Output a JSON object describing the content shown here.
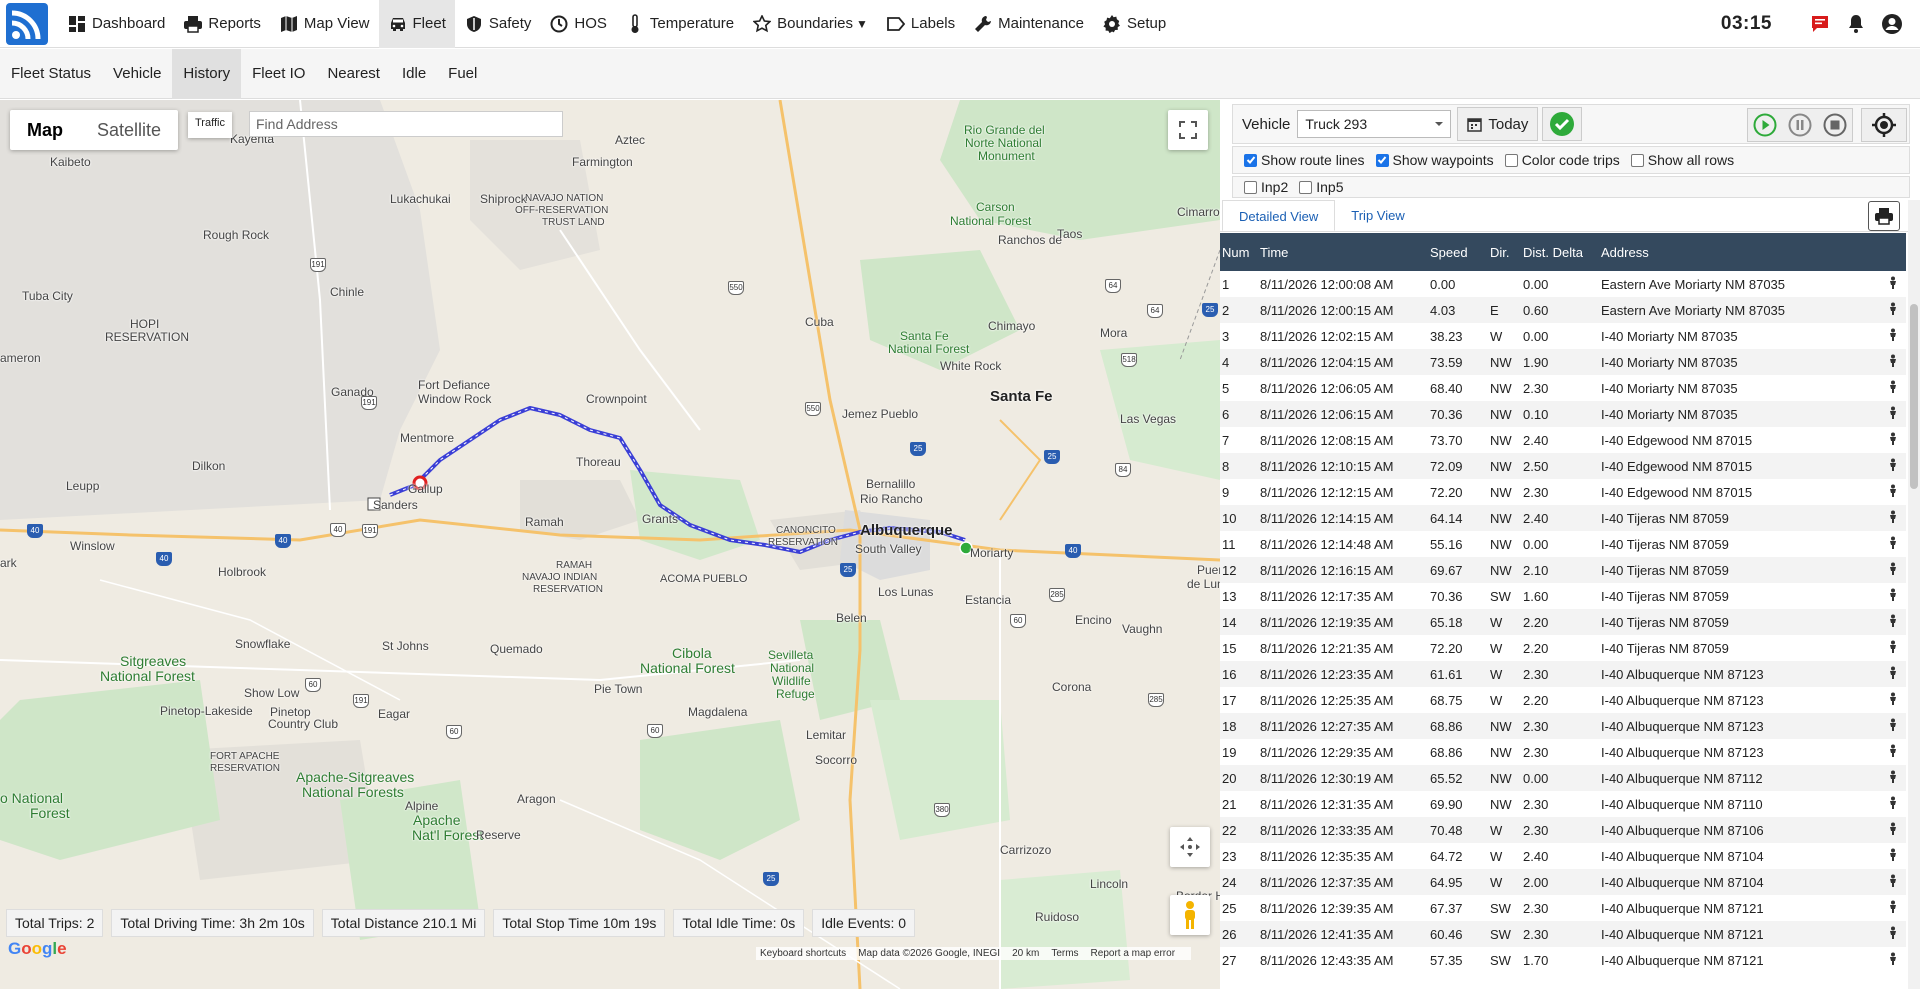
{
  "nav": {
    "items": [
      {
        "label": "Dashboard",
        "icon": "dashboard-icon"
      },
      {
        "label": "Reports",
        "icon": "printer-icon"
      },
      {
        "label": "Map View",
        "icon": "map-icon"
      },
      {
        "label": "Fleet",
        "icon": "car-icon",
        "active": true
      },
      {
        "label": "Safety",
        "icon": "shield-icon"
      },
      {
        "label": "HOS",
        "icon": "clock-icon"
      },
      {
        "label": "Temperature",
        "icon": "thermometer-icon"
      },
      {
        "label": "Boundaries",
        "icon": "star-icon",
        "caret": "▼"
      },
      {
        "label": "Labels",
        "icon": "tag-icon"
      },
      {
        "label": "Maintenance",
        "icon": "wrench-icon"
      },
      {
        "label": "Setup",
        "icon": "gear-icon"
      }
    ],
    "clock": "03:15"
  },
  "subnav": [
    "Fleet Status",
    "Vehicle",
    "History",
    "Fleet IO",
    "Nearest",
    "Idle",
    "Fuel"
  ],
  "subnav_active": "History",
  "map": {
    "type_map": "Map",
    "type_satellite": "Satellite",
    "traffic": "Traffic",
    "find_placeholder": "Find Address",
    "google": "Google",
    "attribution": [
      "Keyboard shortcuts",
      "Map data ©2026 Google, INEGI",
      "20 km",
      "Terms",
      "Report a map error"
    ],
    "labels": {
      "aztec": "Aztec",
      "farmington": "Farmington",
      "shiprock": "Shiprock",
      "kayenta": "Kayenta",
      "kaibeto": "Kaibeto",
      "rough_rock": "Rough Rock",
      "chinle": "Chinle",
      "tuba_city": "Tuba City",
      "lukachukai": "Lukachukai",
      "navajo_1": "NAVAJO NATION",
      "navajo_2": "OFF-RESERVATION",
      "navajo_3": "TRUST LAND",
      "rio_grande_1": "Rio Grande del",
      "rio_grande_2": "Norte National",
      "rio_grande_3": "Monument",
      "carson_1": "Carson",
      "carson_2": "National Forest",
      "ranchos": "Ranchos de",
      "taos": "Taos",
      "cimarron": "Cimarron",
      "cuba": "Cuba",
      "chimayo": "Chimayo",
      "santafe_nf_1": "Santa Fe",
      "santafe_nf_2": "National Forest",
      "white_rock": "White Rock",
      "mora": "Mora",
      "santa_fe": "Santa Fe",
      "las_vegas": "Las Vegas",
      "hopi_1": "HOPI",
      "hopi_2": "RESERVATION",
      "cameron": "ameron",
      "ganado": "Ganado",
      "fort_defiance": "Fort Defiance",
      "window_rock": "Window Rock",
      "crownpoint": "Crownpoint",
      "jemez": "Jemez Pueblo",
      "mentmore": "Mentmore",
      "thoreau": "Thoreau",
      "dilkon": "Dilkon",
      "leupp": "Leupp",
      "gallup": "Gallup",
      "sanders": "Sanders",
      "grants": "Grants",
      "ramah": "Ramah",
      "bernalillo": "Bernalillo",
      "rio_rancho": "Rio Rancho",
      "albuquerque": "Albuquerque",
      "south_valley": "South Valley",
      "moriarty": "Moriarty",
      "canoncito_1": "CANONCITO",
      "canoncito_2": "RESERVATION",
      "puerto": "Puerto",
      "de_luna": "de Luna",
      "winslow": "Winslow",
      "holbrook": "Holbrook",
      "park": "ark",
      "ramah_nav_1": "RAMAH",
      "ramah_nav_2": "NAVAJO INDIAN",
      "ramah_nav_3": "RESERVATION",
      "acoma": "ACOMA PUEBLO",
      "los_lunas": "Los Lunas",
      "estancia": "Estancia",
      "encino": "Encino",
      "belen": "Belen",
      "vaughn": "Vaughn",
      "snowflake": "Snowflake",
      "sitgreaves_1": "Sitgreaves",
      "sitgreaves_2": "National Forest",
      "st_johns": "St Johns",
      "quemado": "Quemado",
      "cibola_1": "Cibola",
      "cibola_2": "National Forest",
      "sevilleta_1": "Sevilleta",
      "sevilleta_2": "National",
      "sevilleta_3": "Wildlife",
      "sevilleta_4": "Refuge",
      "show_low": "Show Low",
      "pie_town": "Pie Town",
      "pinetop_1": "Pinetop-Lakeside",
      "pinetop_2": "Pinetop",
      "pinetop_3": "Country Club",
      "eagar": "Eagar",
      "magdalena": "Magdalena",
      "lemitar": "Lemitar",
      "socorro": "Socorro",
      "corona": "Corona",
      "fort_apache_1": "FORT APACHE",
      "fort_apache_2": "RESERVATION",
      "apache_sit_1": "Apache-Sitgreaves",
      "apache_sit_2": "National Forests",
      "onal_1": "o National",
      "onal_2": "Forest",
      "alpine": "Alpine",
      "apache_nf_1": "Apache",
      "apache_nf_2": "Nat'l Forest",
      "aragon": "Aragon",
      "reserve": "Reserve",
      "carrizozo": "Carrizozo",
      "lincoln": "Lincoln",
      "ruidoso": "Ruidoso",
      "border": "Border H"
    }
  },
  "stats": [
    "Total Trips: 2",
    "Total Driving Time: 3h 2m 10s",
    "Total Distance 210.1 Mi",
    "Total Stop Time 10m 19s",
    "Total Idle Time: 0s",
    "Idle Events: 0"
  ],
  "panel": {
    "vehicle_label": "Vehicle",
    "vehicle_value": "Truck 293",
    "today": "Today",
    "options": [
      {
        "label": "Show route lines",
        "checked": true
      },
      {
        "label": "Show waypoints",
        "checked": true
      },
      {
        "label": "Color code trips",
        "checked": false
      },
      {
        "label": "Show all rows",
        "checked": false
      }
    ],
    "inputs": [
      {
        "label": "Inp2",
        "checked": false
      },
      {
        "label": "Inp5",
        "checked": false
      }
    ],
    "tabs": [
      "Detailed View",
      "Trip View"
    ],
    "columns": [
      "Num",
      "Time",
      "Speed",
      "Dir.",
      "Dist. Delta",
      "Address"
    ],
    "rows": [
      [
        "1",
        "8/11/2026 12:00:08 AM",
        "0.00",
        "",
        "0.00",
        "Eastern Ave Moriarty NM 87035"
      ],
      [
        "2",
        "8/11/2026 12:00:15 AM",
        "4.03",
        "E",
        "0.60",
        "Eastern Ave Moriarty NM 87035"
      ],
      [
        "3",
        "8/11/2026 12:02:15 AM",
        "38.23",
        "W",
        "0.00",
        "I-40 Moriarty NM 87035"
      ],
      [
        "4",
        "8/11/2026 12:04:15 AM",
        "73.59",
        "NW",
        "1.90",
        "I-40 Moriarty NM 87035"
      ],
      [
        "5",
        "8/11/2026 12:06:05 AM",
        "68.40",
        "NW",
        "2.30",
        "I-40 Moriarty NM 87035"
      ],
      [
        "6",
        "8/11/2026 12:06:15 AM",
        "70.36",
        "NW",
        "0.10",
        "I-40 Moriarty NM 87035"
      ],
      [
        "7",
        "8/11/2026 12:08:15 AM",
        "73.70",
        "NW",
        "2.40",
        "I-40 Edgewood NM 87015"
      ],
      [
        "8",
        "8/11/2026 12:10:15 AM",
        "72.09",
        "NW",
        "2.50",
        "I-40 Edgewood NM 87015"
      ],
      [
        "9",
        "8/11/2026 12:12:15 AM",
        "72.20",
        "NW",
        "2.30",
        "I-40 Edgewood NM 87015"
      ],
      [
        "10",
        "8/11/2026 12:14:15 AM",
        "64.14",
        "NW",
        "2.40",
        "I-40 Tijeras NM 87059"
      ],
      [
        "11",
        "8/11/2026 12:14:48 AM",
        "55.16",
        "NW",
        "0.00",
        "I-40 Tijeras NM 87059"
      ],
      [
        "12",
        "8/11/2026 12:16:15 AM",
        "69.67",
        "NW",
        "2.10",
        "I-40 Tijeras NM 87059"
      ],
      [
        "13",
        "8/11/2026 12:17:35 AM",
        "70.36",
        "SW",
        "1.60",
        "I-40 Tijeras NM 87059"
      ],
      [
        "14",
        "8/11/2026 12:19:35 AM",
        "65.18",
        "W",
        "2.20",
        "I-40 Tijeras NM 87059"
      ],
      [
        "15",
        "8/11/2026 12:21:35 AM",
        "72.20",
        "W",
        "2.20",
        "I-40 Tijeras NM 87059"
      ],
      [
        "16",
        "8/11/2026 12:23:35 AM",
        "61.61",
        "W",
        "2.30",
        "I-40 Albuquerque NM 87123"
      ],
      [
        "17",
        "8/11/2026 12:25:35 AM",
        "68.75",
        "W",
        "2.20",
        "I-40 Albuquerque NM 87123"
      ],
      [
        "18",
        "8/11/2026 12:27:35 AM",
        "68.86",
        "NW",
        "2.30",
        "I-40 Albuquerque NM 87123"
      ],
      [
        "19",
        "8/11/2026 12:29:35 AM",
        "68.86",
        "NW",
        "2.30",
        "I-40 Albuquerque NM 87123"
      ],
      [
        "20",
        "8/11/2026 12:30:19 AM",
        "65.52",
        "NW",
        "0.00",
        "I-40 Albuquerque NM 87112"
      ],
      [
        "21",
        "8/11/2026 12:31:35 AM",
        "69.90",
        "NW",
        "2.30",
        "I-40 Albuquerque NM 87110"
      ],
      [
        "22",
        "8/11/2026 12:33:35 AM",
        "70.48",
        "W",
        "2.30",
        "I-40 Albuquerque NM 87106"
      ],
      [
        "23",
        "8/11/2026 12:35:35 AM",
        "64.72",
        "W",
        "2.40",
        "I-40 Albuquerque NM 87104"
      ],
      [
        "24",
        "8/11/2026 12:37:35 AM",
        "64.95",
        "W",
        "2.00",
        "I-40 Albuquerque NM 87104"
      ],
      [
        "25",
        "8/11/2026 12:39:35 AM",
        "67.37",
        "SW",
        "2.30",
        "I-40 Albuquerque NM 87121"
      ],
      [
        "26",
        "8/11/2026 12:41:35 AM",
        "60.46",
        "SW",
        "2.30",
        "I-40 Albuquerque NM 87121"
      ],
      [
        "27",
        "8/11/2026 12:43:35 AM",
        "57.35",
        "SW",
        "1.70",
        "I-40 Albuquerque NM 87121"
      ]
    ]
  },
  "colors": {
    "route": "#3b3fd6",
    "header_bg": "#34495e",
    "start_marker": "#2eaa3a",
    "end_marker": "#e02020",
    "accent": "#1a73e8"
  }
}
